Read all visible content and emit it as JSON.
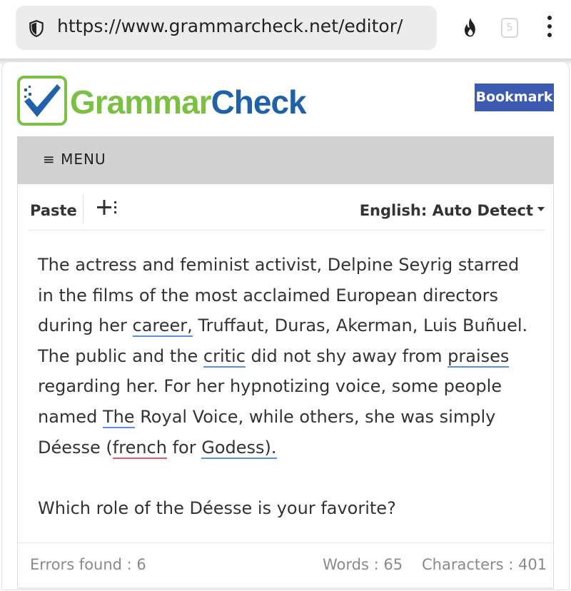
{
  "browser": {
    "url": "https://www.grammarcheck.net/editor/",
    "tab_count": "5"
  },
  "site": {
    "logo_part1": "Grammar",
    "logo_part2": "Check",
    "bookmark_label": "Bookmark",
    "menu_label": "≡ MENU",
    "colors": {
      "logo_green": "#7cc043",
      "logo_blue": "#2061ac",
      "bookmark_bg": "#3c5bb0",
      "menu_bg": "#d2d2d2"
    }
  },
  "editor": {
    "paste_label": "Paste",
    "language_label": "English: Auto Detect",
    "text": {
      "s1": "The actress and feminist activist, Delpine Seyrig starred in the films of the most acclaimed European directors during her ",
      "e_career": "career,",
      "s2": " Truffaut, Duras, Akerman, Luis Buñuel. The public and the ",
      "e_critic": "critic",
      "s3": " did not shy away from ",
      "e_praises": "praises",
      "s4": " regarding her. For her hypnotizing voice, some people named ",
      "e_the": "The",
      "s5": " Royal Voice, while others, she was simply Déesse (",
      "e_french": "french",
      "s6": " for ",
      "e_godess": "Godess).",
      "p2": "Which role of the Déesse is your favorite?"
    },
    "underline_colors": {
      "grammar": "#5b8fe0",
      "spelling": "#e05b6b"
    }
  },
  "status": {
    "errors": "Errors found : 6",
    "words": "Words : 65",
    "characters": "Characters : 401"
  }
}
